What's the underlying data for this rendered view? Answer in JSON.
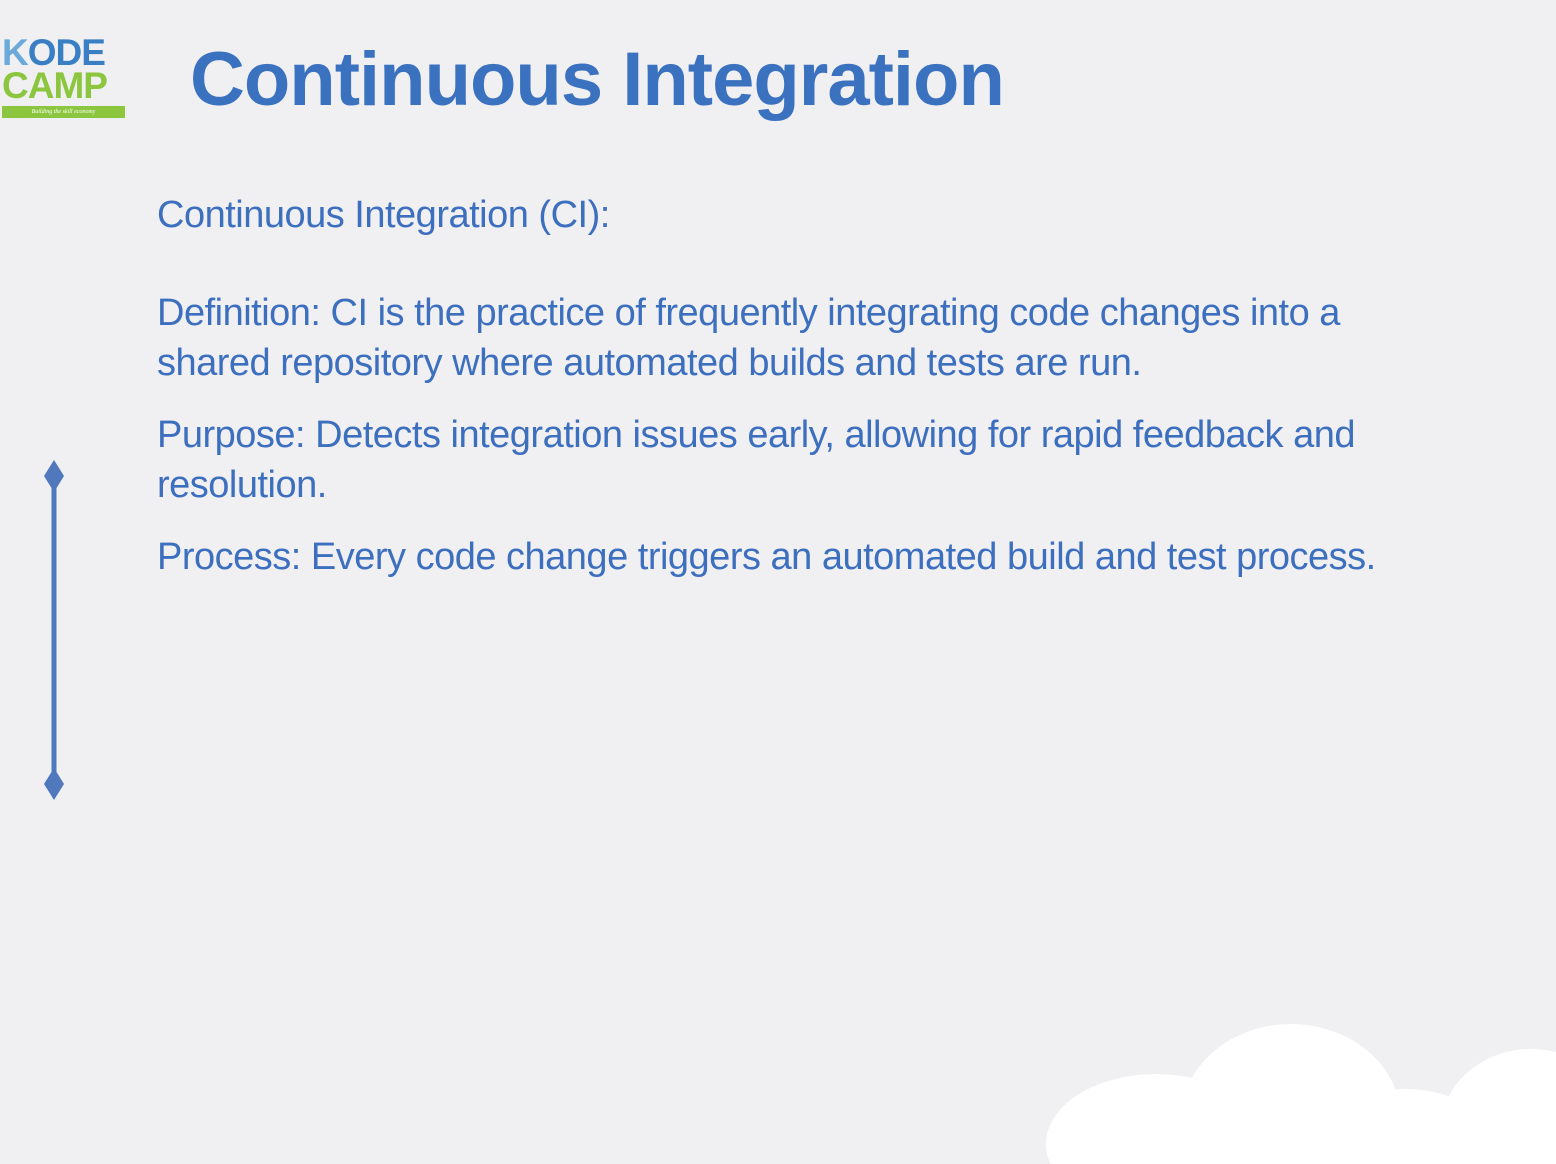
{
  "logo": {
    "line1_first": "K",
    "line1_rest": "ODE",
    "line2": "CAMP",
    "tagline": "Building the skill economy"
  },
  "slide": {
    "title": "Continuous Integration",
    "subtitle": "Continuous Integration (CI):",
    "points": [
      "Definition: CI is the practice of frequently integrating code changes into a shared repository where automated builds and tests are run.",
      "Purpose: Detects integration issues early, allowing for rapid feedback and resolution.",
      "Process: Every code change triggers an automated build and test process."
    ]
  },
  "colors": {
    "background": "#f0eff2",
    "title": "#3b72c0",
    "body_text": "#3d6fbf",
    "timeline": "#4f78bd",
    "logo_blue": "#3a7fc4",
    "logo_green": "#8cc63f",
    "cloud": "#ffffff"
  },
  "icons": {
    "timeline": "vertical-line-with-diamond-ends-icon",
    "decoration": "cloud-icon"
  }
}
